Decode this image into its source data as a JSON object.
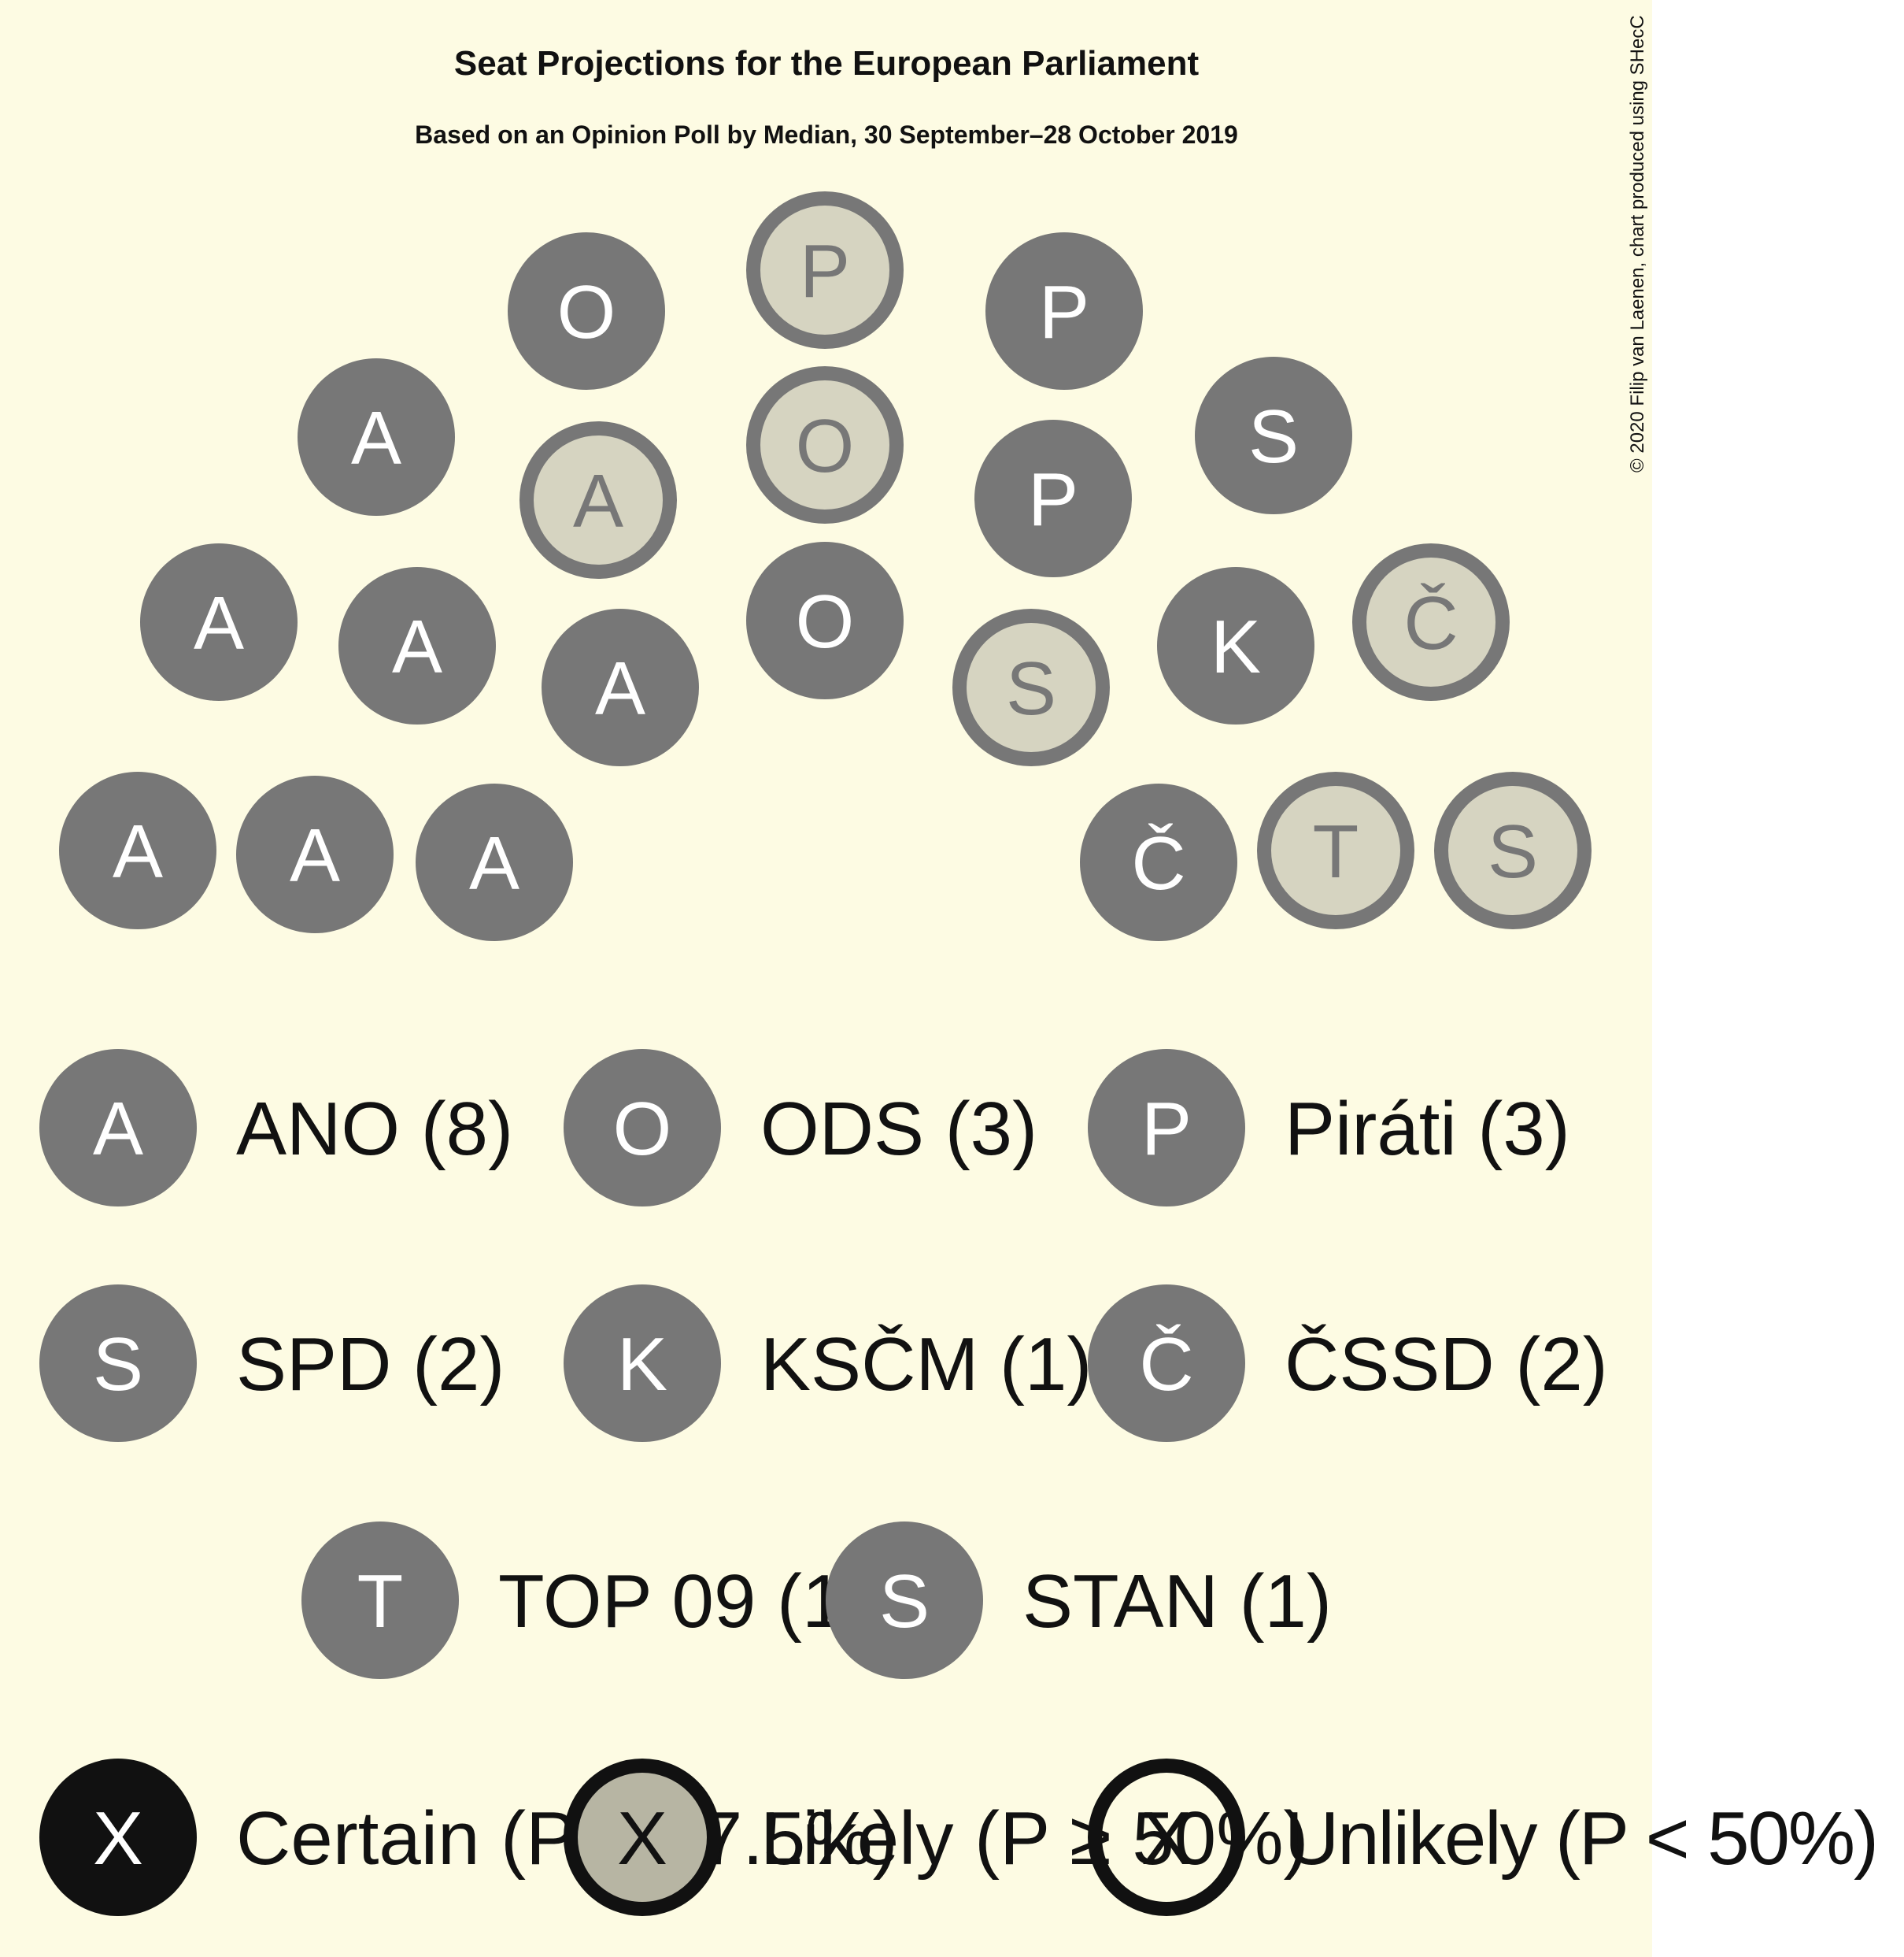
{
  "title": "Seat Projections for the European Parliament",
  "subtitle": "Based on an Opinion Poll by Median, 30 September–28 October 2019",
  "copyright": "© 2020 Filip van Laenen, chart produced using SHecC",
  "colors": {
    "background": "#fdfbe3",
    "seat_fill": "#777777",
    "seat_text": "#ffffff",
    "likely_fill": "#d6d4c1",
    "likely_ring": "#777777",
    "likely_text": "#777777",
    "text": "#111111",
    "certain_fill": "#111111",
    "legend_likely_fill": "#b7b5a3"
  },
  "chart_data": {
    "type": "parliament",
    "parties": [
      {
        "code": "A",
        "label": "ANO (8)",
        "seats": 8,
        "certain": 7,
        "likely": 1
      },
      {
        "code": "O",
        "label": "ODS (3)",
        "seats": 3,
        "certain": 2,
        "likely": 1
      },
      {
        "code": "P",
        "label": "Piráti (3)",
        "seats": 3,
        "certain": 2,
        "likely": 1
      },
      {
        "code": "S",
        "label": "SPD (2)",
        "seats": 2,
        "certain": 1,
        "likely": 1
      },
      {
        "code": "K",
        "label": "KSČM (1)",
        "seats": 1,
        "certain": 1,
        "likely": 0
      },
      {
        "code": "Č",
        "label": "ČSSD (2)",
        "seats": 2,
        "certain": 1,
        "likely": 1
      },
      {
        "code": "T",
        "label": "TOP 09 (1)",
        "seats": 1,
        "certain": 0,
        "likely": 1
      },
      {
        "code": "S",
        "label": "STAN (1)",
        "seats": 1,
        "certain": 0,
        "likely": 1
      }
    ],
    "seats": [
      {
        "party": "A",
        "status": "certain"
      },
      {
        "party": "A",
        "status": "certain"
      },
      {
        "party": "A",
        "status": "certain"
      },
      {
        "party": "A",
        "status": "certain"
      },
      {
        "party": "A",
        "status": "certain"
      },
      {
        "party": "A",
        "status": "certain"
      },
      {
        "party": "A",
        "status": "certain"
      },
      {
        "party": "A",
        "status": "likely"
      },
      {
        "party": "O",
        "status": "certain"
      },
      {
        "party": "P",
        "status": "likely"
      },
      {
        "party": "O",
        "status": "likely"
      },
      {
        "party": "O",
        "status": "certain"
      },
      {
        "party": "P",
        "status": "certain"
      },
      {
        "party": "P",
        "status": "certain"
      },
      {
        "party": "S",
        "status": "likely"
      },
      {
        "party": "S",
        "status": "certain"
      },
      {
        "party": "K",
        "status": "certain"
      },
      {
        "party": "Č",
        "status": "likely"
      },
      {
        "party": "Č",
        "status": "certain"
      },
      {
        "party": "T",
        "status": "likely"
      },
      {
        "party": "S",
        "status": "likely"
      }
    ],
    "legend_status": [
      {
        "symbol": "X",
        "label": "Certain (P ≥ 97.5%)"
      },
      {
        "symbol": "X",
        "label": "Likely (P ≥ 50%)"
      },
      {
        "symbol": "X",
        "label": "Unlikely (P < 50%)"
      }
    ]
  }
}
